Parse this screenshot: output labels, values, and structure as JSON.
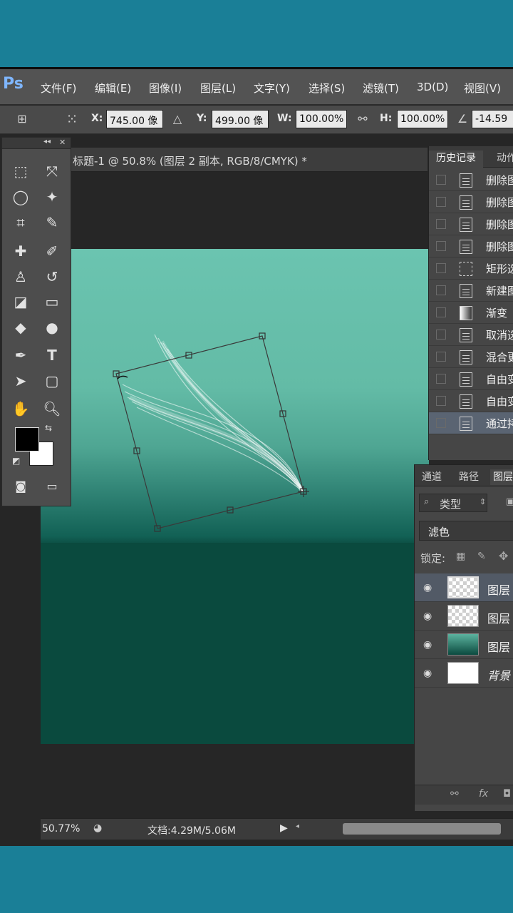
{
  "app": {
    "logo": "Ps"
  },
  "menu": [
    "文件(F)",
    "编辑(E)",
    "图像(I)",
    "图层(L)",
    "文字(Y)",
    "选择(S)",
    "滤镜(T)",
    "3D(D)",
    "视图(V)"
  ],
  "options": {
    "x_label": "X:",
    "x_value": "745.00 像",
    "y_label": "Y:",
    "y_value": "499.00 像",
    "w_label": "W:",
    "w_value": "100.00%",
    "h_label": "H:",
    "h_value": "100.00%",
    "angle_value": "-14.59"
  },
  "document": {
    "title": "标题-1 @ 50.8% (图层 2 副本, RGB/8/CMYK) *"
  },
  "history": {
    "tabs": [
      "历史记录",
      "动作"
    ],
    "items": [
      {
        "label": "删除图",
        "icon": "document-icon"
      },
      {
        "label": "删除图",
        "icon": "document-icon"
      },
      {
        "label": "删除图",
        "icon": "document-icon"
      },
      {
        "label": "删除图",
        "icon": "document-icon"
      },
      {
        "label": "矩形选",
        "icon": "marquee-icon"
      },
      {
        "label": "新建图",
        "icon": "document-icon"
      },
      {
        "label": "渐变",
        "icon": "gradient-icon"
      },
      {
        "label": "取消选",
        "icon": "document-icon"
      },
      {
        "label": "混合更",
        "icon": "document-icon"
      },
      {
        "label": "自由变",
        "icon": "document-icon"
      },
      {
        "label": "自由变",
        "icon": "document-icon"
      },
      {
        "label": "通过拷",
        "icon": "document-icon"
      }
    ]
  },
  "layers": {
    "tabs": [
      "通道",
      "路径",
      "图层"
    ],
    "filter_kind": "类型",
    "blend_mode": "滤色",
    "lock_label": "锁定:",
    "items": [
      {
        "name": "图层",
        "thumb": "transparent"
      },
      {
        "name": "图层",
        "thumb": "transparent"
      },
      {
        "name": "图层",
        "thumb": "gradient"
      },
      {
        "name": "背景",
        "thumb": "white"
      }
    ]
  },
  "status": {
    "zoom": "50.77%",
    "doc_info": "文档:4.29M/5.06M"
  },
  "colors": {
    "accent_bg": "#1a7f97",
    "canvas_top": "#6bc4b0",
    "canvas_bottom": "#0a4a3e"
  }
}
